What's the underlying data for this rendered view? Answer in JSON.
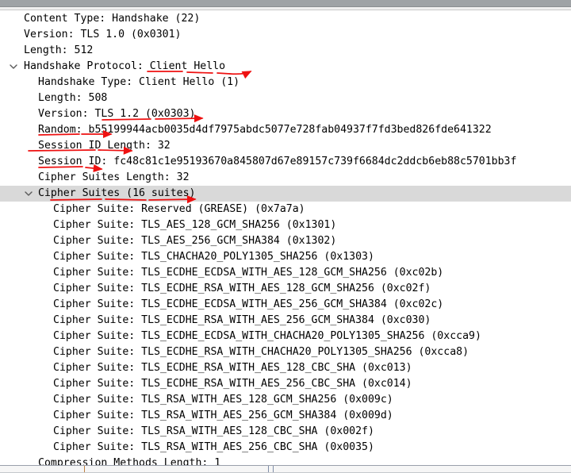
{
  "app": {
    "name": "wireshark-packet-details",
    "pane": "packet-detail-tree"
  },
  "colors": {
    "selection": "#d9d9d9",
    "annotation": "#ee1111",
    "text": "#000000",
    "splitter": "#9fa3a6"
  },
  "tree": {
    "rows": [
      {
        "id": "content-type",
        "indent": 1,
        "expander": "none",
        "text": "Content Type: Handshake (22)",
        "selected": false
      },
      {
        "id": "version-record",
        "indent": 1,
        "expander": "none",
        "text": "Version: TLS 1.0 (0x0301)",
        "selected": false
      },
      {
        "id": "length-record",
        "indent": 1,
        "expander": "none",
        "text": "Length: 512",
        "selected": false
      },
      {
        "id": "handshake-protocol",
        "indent": 1,
        "expander": "expanded",
        "text": "Handshake Protocol: Client Hello",
        "selected": false
      },
      {
        "id": "handshake-type",
        "indent": 2,
        "expander": "none",
        "text": "Handshake Type: Client Hello (1)",
        "selected": false
      },
      {
        "id": "length-handshake",
        "indent": 2,
        "expander": "none",
        "text": "Length: 508",
        "selected": false
      },
      {
        "id": "version-handshake",
        "indent": 2,
        "expander": "none",
        "text": "Version: TLS 1.2 (0x0303)",
        "selected": false
      },
      {
        "id": "random",
        "indent": 2,
        "expander": "none",
        "text": "Random: b55199944acb0035d4df7975abdc5077e728fab04937f7fd3bed826fde641322",
        "selected": false
      },
      {
        "id": "session-id-length",
        "indent": 2,
        "expander": "none",
        "text": "Session ID Length: 32",
        "selected": false
      },
      {
        "id": "session-id",
        "indent": 2,
        "expander": "none",
        "text": "Session ID: fc48c81c1e95193670a845807d67e89157c739f6684dc2ddcb6eb88c5701bb3f",
        "selected": false
      },
      {
        "id": "cipher-suites-length",
        "indent": 2,
        "expander": "none",
        "text": "Cipher Suites Length: 32",
        "selected": false
      },
      {
        "id": "cipher-suites",
        "indent": 2,
        "expander": "expanded",
        "text": "Cipher Suites (16 suites)",
        "selected": true
      },
      {
        "id": "cipher-suite-0",
        "indent": 3,
        "expander": "none",
        "text": "Cipher Suite: Reserved (GREASE) (0x7a7a)",
        "selected": false
      },
      {
        "id": "cipher-suite-1",
        "indent": 3,
        "expander": "none",
        "text": "Cipher Suite: TLS_AES_128_GCM_SHA256 (0x1301)",
        "selected": false
      },
      {
        "id": "cipher-suite-2",
        "indent": 3,
        "expander": "none",
        "text": "Cipher Suite: TLS_AES_256_GCM_SHA384 (0x1302)",
        "selected": false
      },
      {
        "id": "cipher-suite-3",
        "indent": 3,
        "expander": "none",
        "text": "Cipher Suite: TLS_CHACHA20_POLY1305_SHA256 (0x1303)",
        "selected": false
      },
      {
        "id": "cipher-suite-4",
        "indent": 3,
        "expander": "none",
        "text": "Cipher Suite: TLS_ECDHE_ECDSA_WITH_AES_128_GCM_SHA256 (0xc02b)",
        "selected": false
      },
      {
        "id": "cipher-suite-5",
        "indent": 3,
        "expander": "none",
        "text": "Cipher Suite: TLS_ECDHE_RSA_WITH_AES_128_GCM_SHA256 (0xc02f)",
        "selected": false
      },
      {
        "id": "cipher-suite-6",
        "indent": 3,
        "expander": "none",
        "text": "Cipher Suite: TLS_ECDHE_ECDSA_WITH_AES_256_GCM_SHA384 (0xc02c)",
        "selected": false
      },
      {
        "id": "cipher-suite-7",
        "indent": 3,
        "expander": "none",
        "text": "Cipher Suite: TLS_ECDHE_RSA_WITH_AES_256_GCM_SHA384 (0xc030)",
        "selected": false
      },
      {
        "id": "cipher-suite-8",
        "indent": 3,
        "expander": "none",
        "text": "Cipher Suite: TLS_ECDHE_ECDSA_WITH_CHACHA20_POLY1305_SHA256 (0xcca9)",
        "selected": false
      },
      {
        "id": "cipher-suite-9",
        "indent": 3,
        "expander": "none",
        "text": "Cipher Suite: TLS_ECDHE_RSA_WITH_CHACHA20_POLY1305_SHA256 (0xcca8)",
        "selected": false
      },
      {
        "id": "cipher-suite-10",
        "indent": 3,
        "expander": "none",
        "text": "Cipher Suite: TLS_ECDHE_RSA_WITH_AES_128_CBC_SHA (0xc013)",
        "selected": false
      },
      {
        "id": "cipher-suite-11",
        "indent": 3,
        "expander": "none",
        "text": "Cipher Suite: TLS_ECDHE_RSA_WITH_AES_256_CBC_SHA (0xc014)",
        "selected": false
      },
      {
        "id": "cipher-suite-12",
        "indent": 3,
        "expander": "none",
        "text": "Cipher Suite: TLS_RSA_WITH_AES_128_GCM_SHA256 (0x009c)",
        "selected": false
      },
      {
        "id": "cipher-suite-13",
        "indent": 3,
        "expander": "none",
        "text": "Cipher Suite: TLS_RSA_WITH_AES_256_GCM_SHA384 (0x009d)",
        "selected": false
      },
      {
        "id": "cipher-suite-14",
        "indent": 3,
        "expander": "none",
        "text": "Cipher Suite: TLS_RSA_WITH_AES_128_CBC_SHA (0x002f)",
        "selected": false
      },
      {
        "id": "cipher-suite-15",
        "indent": 3,
        "expander": "none",
        "text": "Cipher Suite: TLS_RSA_WITH_AES_256_CBC_SHA (0x0035)",
        "selected": false
      },
      {
        "id": "compression-methods-length",
        "indent": 2,
        "expander": "none",
        "text": "Compression Methods Length: 1",
        "selected": false
      }
    ]
  },
  "annotations": {
    "description": "hand-drawn red underline strokes with arrowheads",
    "marks": [
      {
        "id": "mark-client-hello",
        "target": "Handshake Protocol: Client Hello"
      },
      {
        "id": "mark-tls12",
        "target": "Version: TLS 1.2 (0x0303)"
      },
      {
        "id": "mark-random",
        "target": "Random"
      },
      {
        "id": "mark-session-id-length",
        "target": "Session ID Length"
      },
      {
        "id": "mark-session-id",
        "target": "Session ID"
      },
      {
        "id": "mark-cipher-suites",
        "target": "Cipher Suites (16 suites)"
      }
    ]
  }
}
